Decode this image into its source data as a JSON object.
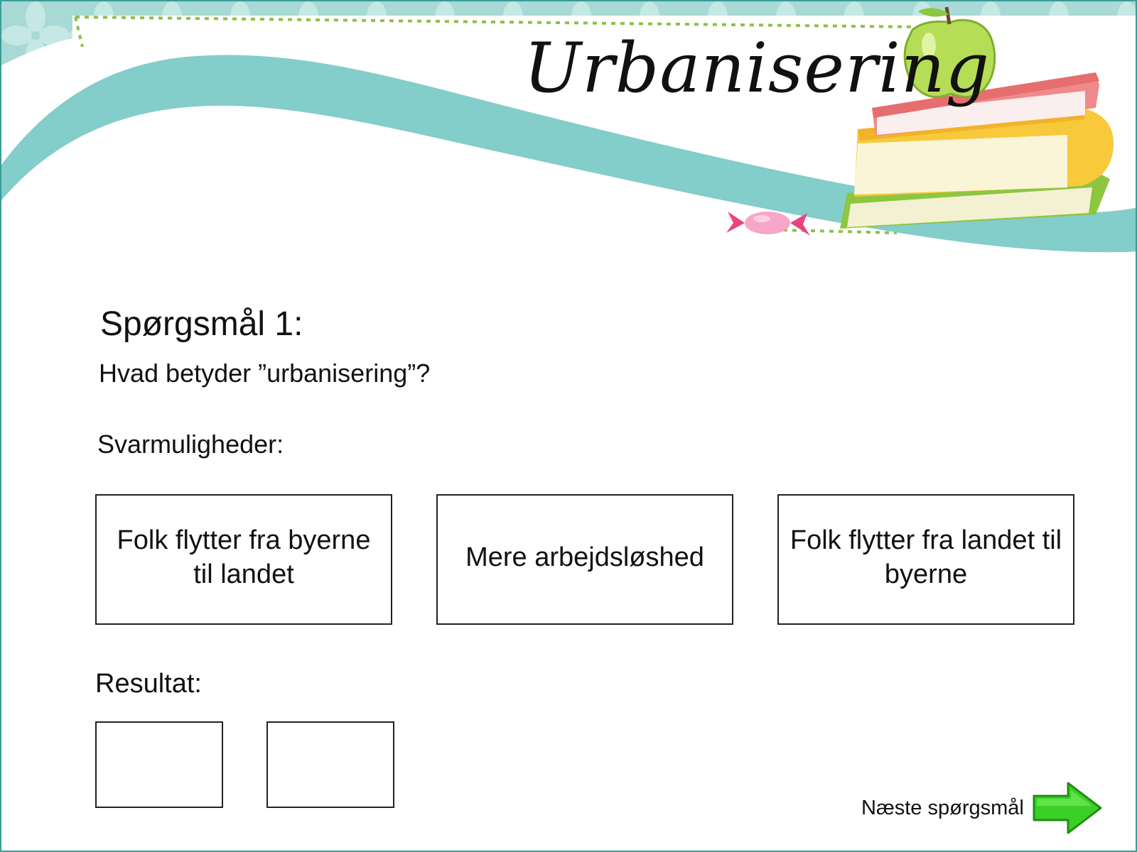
{
  "slide": {
    "title": "Urbanisering",
    "question_heading": "Spørgsmål 1:",
    "question_text": "Hvad betyder ”urbanisering”?",
    "options_label": "Svarmuligheder:",
    "options": [
      {
        "label": "Folk flytter fra byerne til landet"
      },
      {
        "label": "Mere arbejdsløshed"
      },
      {
        "label": "Folk flytter fra landet til byerne"
      }
    ],
    "result_label": "Resultat:",
    "result_slots": [
      "",
      ""
    ],
    "next_label": "Næste spørgsmål",
    "next_icon": "green-right-arrow-icon"
  },
  "colors": {
    "teal_wave": "#83cdca",
    "teal_pattern": "#bfe3e1",
    "dotted_line": "#8fc045",
    "book_pink": "#f08a8a",
    "book_yellow": "#f7c93b",
    "book_green": "#8dc63f",
    "apple_green": "#b5dd55",
    "candy_pink": "#f06fa4",
    "arrow_green": "#3bd026",
    "frame": "#3a9d97"
  }
}
